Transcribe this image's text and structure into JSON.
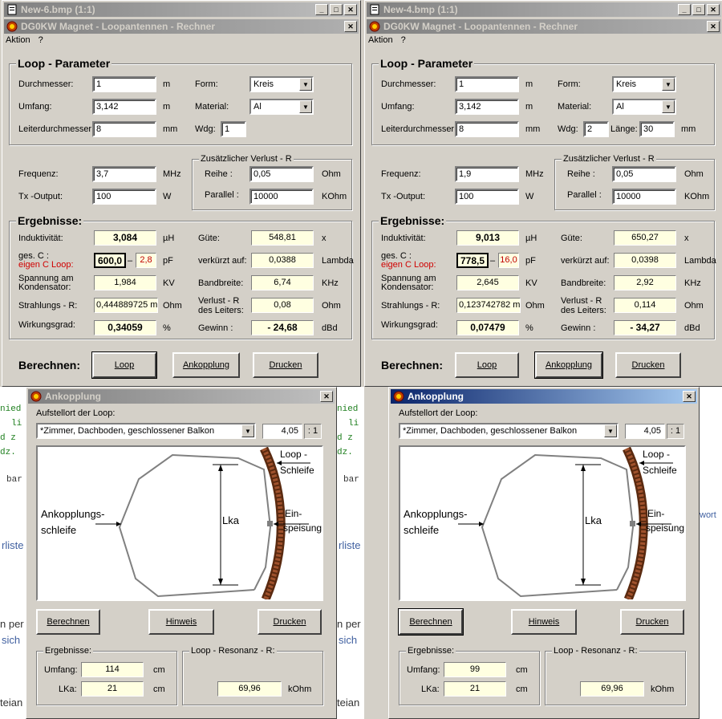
{
  "colors": {
    "active_title": "#0a246a",
    "inactive_title": "#808080",
    "result_bg": "#ffffe1",
    "red": "#d00000"
  },
  "background_text": {
    "green": [
      "nied",
      "li",
      "d z",
      "dz."
    ],
    "gray": [
      "bar",
      "rliste",
      "n per",
      "sich",
      "teian"
    ],
    "wort": "wort"
  },
  "windows": [
    {
      "frame_title": "New-6.bmp (1:1)",
      "app_title": "DG0KW   Magnet - Loopantennen - Rechner",
      "menu": [
        "Aktion",
        "?"
      ],
      "loop_param": {
        "title": "Loop - Parameter",
        "durchmesser_label": "Durchmesser:",
        "durchmesser": "1",
        "durchmesser_unit": "m",
        "umfang_label": "Umfang:",
        "umfang": "3,142",
        "umfang_unit": "m",
        "leiter_label": "Leiterdurchmesser:",
        "leiter": "8",
        "leiter_unit": "mm",
        "form_label": "Form:",
        "form": "Kreis",
        "material_label": "Material:",
        "material": "Al",
        "wdg_label": "Wdg:",
        "wdg": "1",
        "laenge_label": "",
        "laenge": "",
        "laenge_unit": ""
      },
      "freq_label": "Frequenz:",
      "freq": "3,7",
      "freq_unit": "MHz",
      "tx_label": "Tx -Output:",
      "tx": "100",
      "tx_unit": "W",
      "verlust": {
        "title": "Zusätzlicher Verlust - R",
        "reihe_label": "Reihe :",
        "reihe": "0,05",
        "reihe_unit": "Ohm",
        "parallel_label": "Parallel :",
        "parallel": "10000",
        "parallel_unit": "KOhm"
      },
      "results": {
        "title": "Ergebnisse:",
        "induktivitaet_label": "Induktivität:",
        "induktivitaet": "3,084",
        "induktivitaet_unit": "µH",
        "gesc_label": "ges.  C      :",
        "eigenc_label": "eigen C  Loop:",
        "gesc": "600,0",
        "dash": "–",
        "eigenc": "2,8",
        "c_unit": "pF",
        "spannung_label1": "Spannung am",
        "spannung_label2": "Kondensator:",
        "spannung": "1,984",
        "spannung_unit": "KV",
        "strahlung_label": "Strahlungs - R:",
        "strahlung": "0,444889725 m",
        "strahlung_unit": "Ohm",
        "wirkung_label": "Wirkungsgrad:",
        "wirkung": "0,34059",
        "wirkung_unit": "%",
        "guete_label": "Güte:",
        "guete": "548,81",
        "guete_unit": "x",
        "verkuerzt_label": "verkürzt auf:",
        "verkuerzt": "0,0388",
        "verkuerzt_unit": "Lambda",
        "bandbreite_label": "Bandbreite:",
        "bandbreite": "6,74",
        "bandbreite_unit": "KHz",
        "verlustr_label1": "Verlust - R",
        "verlustr_label2": "des Leiters:",
        "verlustr": "0,08",
        "verlustr_unit": "Ohm",
        "gewinn_label": "Gewinn :",
        "gewinn": "- 24,68",
        "gewinn_unit": "dBd"
      },
      "berechnen_label": "Berechnen:",
      "buttons": {
        "loop": "Loop",
        "ankopplung": "Ankopplung",
        "drucken": "Drucken"
      },
      "ank": {
        "title": "Ankopplung",
        "aufstellort_label": "Aufstellort der Loop:",
        "aufstellort": "*Zimmer, Dachboden, geschlossener Balkon",
        "factor": "4,05",
        "factor_suffix": ": 1",
        "diagram": {
          "loop1": "Loop -",
          "loop2": "Schleife",
          "ank1": "Ankopplungs-",
          "ank2": "schleife",
          "lka": "Lka",
          "ein1": "Ein-",
          "ein2": "speisung"
        },
        "buttons": {
          "berechnen": "Berechnen",
          "hinweis": "Hinweis",
          "drucken": "Drucken"
        },
        "ergebnisse_label": "Ergebnisse:",
        "umfang_label": "Umfang:",
        "umfang": "114",
        "umfang_unit": "cm",
        "lka_label": "LKa:",
        "lka": "21",
        "lka_unit": "cm",
        "resonanz_label": "Loop - Resonanz - R:",
        "resonanz": "69,96",
        "resonanz_unit": "kOhm"
      }
    },
    {
      "frame_title": "New-4.bmp (1:1)",
      "app_title": "DG0KW   Magnet - Loopantennen - Rechner",
      "menu": [
        "Aktion",
        "?"
      ],
      "loop_param": {
        "title": "Loop - Parameter",
        "durchmesser_label": "Durchmesser:",
        "durchmesser": "1",
        "durchmesser_unit": "m",
        "umfang_label": "Umfang:",
        "umfang": "3,142",
        "umfang_unit": "m",
        "leiter_label": "Leiterdurchmesser:",
        "leiter": "8",
        "leiter_unit": "mm",
        "form_label": "Form:",
        "form": "Kreis",
        "material_label": "Material:",
        "material": "Al",
        "wdg_label": "Wdg:",
        "wdg": "2",
        "laenge_label": "Länge:",
        "laenge": "30",
        "laenge_unit": "mm"
      },
      "freq_label": "Frequenz:",
      "freq": "1,9",
      "freq_unit": "MHz",
      "tx_label": "Tx -Output:",
      "tx": "100",
      "tx_unit": "W",
      "verlust": {
        "title": "Zusätzlicher Verlust - R",
        "reihe_label": "Reihe :",
        "reihe": "0,05",
        "reihe_unit": "Ohm",
        "parallel_label": "Parallel :",
        "parallel": "10000",
        "parallel_unit": "KOhm"
      },
      "results": {
        "title": "Ergebnisse:",
        "induktivitaet_label": "Induktivität:",
        "induktivitaet": "9,013",
        "induktivitaet_unit": "µH",
        "gesc_label": "ges.  C      :",
        "eigenc_label": "eigen C  Loop:",
        "gesc": "778,5",
        "dash": "–",
        "eigenc": "16,0",
        "c_unit": "pF",
        "spannung_label1": "Spannung am",
        "spannung_label2": "Kondensator:",
        "spannung": "2,645",
        "spannung_unit": "KV",
        "strahlung_label": "Strahlungs - R:",
        "strahlung": "0,123742782 m",
        "strahlung_unit": "Ohm",
        "wirkung_label": "Wirkungsgrad:",
        "wirkung": "0,07479",
        "wirkung_unit": "%",
        "guete_label": "Güte:",
        "guete": "650,27",
        "guete_unit": "x",
        "verkuerzt_label": "verkürzt auf:",
        "verkuerzt": "0,0398",
        "verkuerzt_unit": "Lambda",
        "bandbreite_label": "Bandbreite:",
        "bandbreite": "2,92",
        "bandbreite_unit": "KHz",
        "verlustr_label1": "Verlust - R",
        "verlustr_label2": "des Leiters:",
        "verlustr": "0,114",
        "verlustr_unit": "Ohm",
        "gewinn_label": "Gewinn :",
        "gewinn": "- 34,27",
        "gewinn_unit": "dBd"
      },
      "berechnen_label": "Berechnen:",
      "buttons": {
        "loop": "Loop",
        "ankopplung": "Ankopplung",
        "drucken": "Drucken"
      },
      "ank": {
        "title": "Ankopplung",
        "aufstellort_label": "Aufstellort der Loop:",
        "aufstellort": "*Zimmer, Dachboden, geschlossener Balkon",
        "factor": "4,05",
        "factor_suffix": ": 1",
        "diagram": {
          "loop1": "Loop -",
          "loop2": "Schleife",
          "ank1": "Ankopplungs-",
          "ank2": "schleife",
          "lka": "Lka",
          "ein1": "Ein-",
          "ein2": "speisung"
        },
        "buttons": {
          "berechnen": "Berechnen",
          "hinweis": "Hinweis",
          "drucken": "Drucken"
        },
        "ergebnisse_label": "Ergebnisse:",
        "umfang_label": "Umfang:",
        "umfang": "99",
        "umfang_unit": "cm",
        "lka_label": "LKa:",
        "lka": "21",
        "lka_unit": "cm",
        "resonanz_label": "Loop - Resonanz - R:",
        "resonanz": "69,96",
        "resonanz_unit": "kOhm"
      }
    }
  ]
}
